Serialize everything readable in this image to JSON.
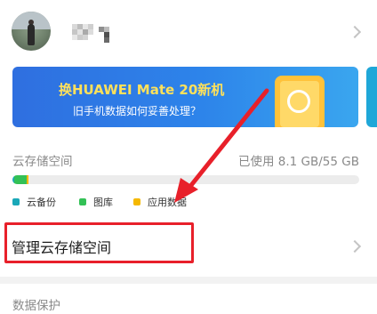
{
  "profile": {
    "avatar_icon": "user-avatar-photo",
    "username_blurred": true
  },
  "banner": {
    "title": "换HUAWEI Mate 20新机",
    "subtitle": "旧手机数据如何妥善处理？",
    "illustration_icon": "phone-transfer-icon",
    "color_start": "#2f6fe0",
    "color_end": "#3aa6ef",
    "title_color": "#ffe15a"
  },
  "storage": {
    "title": "云存储空间",
    "used_text": "已使用 8.1 GB/55 GB",
    "used_gb": 8.1,
    "total_gb": 55,
    "bar_fractions": {
      "cloud_backup": 0.006,
      "gallery": 0.036,
      "app_data": 0.005
    },
    "legend": [
      {
        "label": "云备份",
        "color": "#1aa8b8"
      },
      {
        "label": "图库",
        "color": "#33c156"
      },
      {
        "label": "应用数据",
        "color": "#f5b800"
      }
    ]
  },
  "manage": {
    "label": "管理云存储空间",
    "chevron_icon": "chevron-right-icon"
  },
  "annotation": {
    "highlight_color": "#e8202a"
  },
  "data_protection": {
    "title": "数据保护"
  }
}
